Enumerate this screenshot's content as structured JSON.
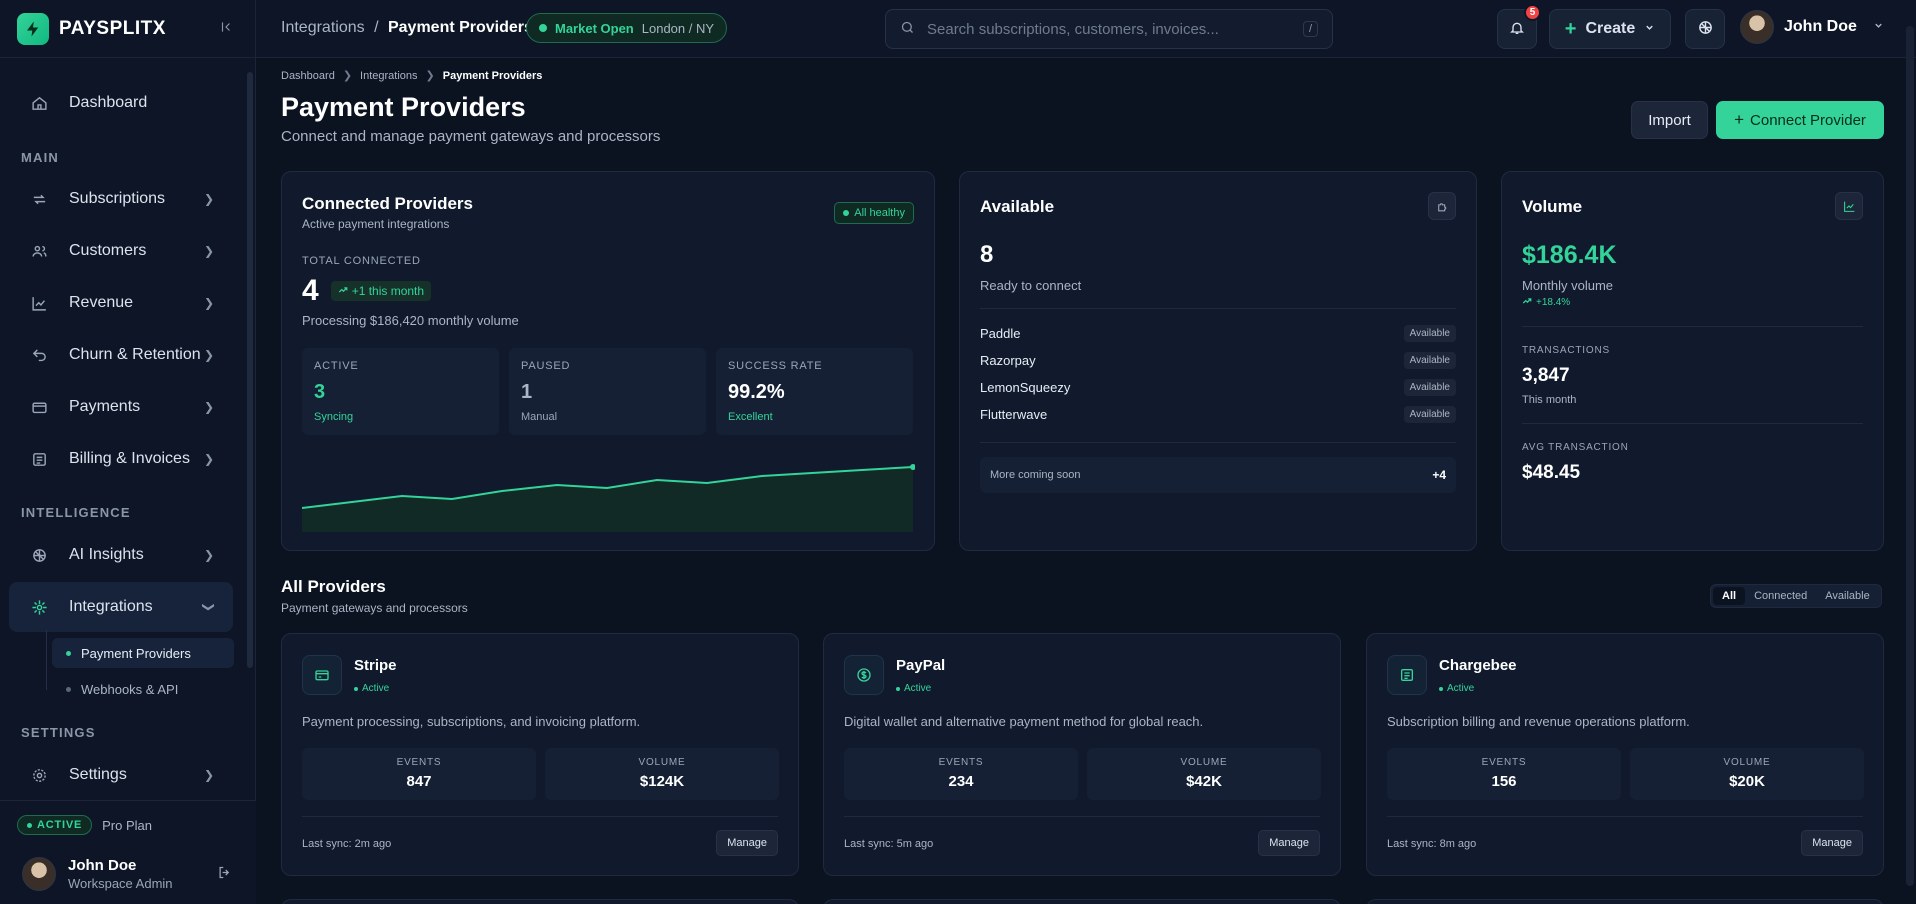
{
  "brand": {
    "name": "PAYSPLITX"
  },
  "sidebar": {
    "items": [
      {
        "label": "Dashboard"
      },
      {
        "label": "Subscriptions"
      },
      {
        "label": "Customers"
      },
      {
        "label": "Revenue"
      },
      {
        "label": "Churn & Retention"
      },
      {
        "label": "Payments"
      },
      {
        "label": "Billing & Invoices"
      },
      {
        "label": "AI Insights"
      },
      {
        "label": "Integrations"
      },
      {
        "label": "Settings"
      }
    ],
    "sections": {
      "main": "MAIN",
      "intelligence": "INTELLIGENCE",
      "settings": "SETTINGS"
    },
    "subitems": [
      {
        "label": "Payment Providers"
      },
      {
        "label": "Webhooks & API"
      }
    ],
    "plan": {
      "badge": "ACTIVE",
      "name": "Pro Plan"
    },
    "user": {
      "name": "John Doe",
      "role": "Workspace Admin"
    }
  },
  "topbar": {
    "crumb_parent": "Integrations",
    "crumb_sep": "/",
    "crumb_current": "Payment Providers",
    "market_status": "Market Open",
    "market_location": "London / NY",
    "search_placeholder": "Search subscriptions, customers, invoices...",
    "search_shortcut": "/",
    "notifications_count": "5",
    "create_label": "Create",
    "user_name": "John Doe"
  },
  "page": {
    "breadcrumb": [
      "Dashboard",
      "Integrations",
      "Payment Providers"
    ],
    "title": "Payment Providers",
    "subtitle": "Connect and manage payment gateways and processors",
    "import_label": "Import",
    "connect_label": "Connect Provider"
  },
  "connected": {
    "title": "Connected Providers",
    "subtitle": "Active payment integrations",
    "status": "All healthy",
    "total_label": "TOTAL CONNECTED",
    "total": "4",
    "delta": "+1 this month",
    "processing": "Processing $186,420 monthly volume",
    "stats": [
      {
        "label": "ACTIVE",
        "value": "3",
        "sub": "Syncing"
      },
      {
        "label": "PAUSED",
        "value": "1",
        "sub": "Manual"
      },
      {
        "label": "SUCCESS RATE",
        "value": "99.2%",
        "sub": "Excellent"
      }
    ]
  },
  "available": {
    "title": "Available",
    "count": "8",
    "count_sub": "Ready to connect",
    "providers": [
      {
        "name": "Paddle",
        "tag": "Available"
      },
      {
        "name": "Razorpay",
        "tag": "Available"
      },
      {
        "name": "LemonSqueezy",
        "tag": "Available"
      },
      {
        "name": "Flutterwave",
        "tag": "Available"
      }
    ],
    "more_label": "More coming soon",
    "more_count": "+4"
  },
  "volume": {
    "title": "Volume",
    "amount": "$186.4K",
    "amount_sub": "Monthly volume",
    "delta": "+18.4%",
    "tx_label": "TRANSACTIONS",
    "tx_value": "3,847",
    "tx_sub": "This month",
    "avg_label": "AVG TRANSACTION",
    "avg_value": "$48.45"
  },
  "all_providers": {
    "title": "All Providers",
    "subtitle": "Payment gateways and processors",
    "filters": [
      "All",
      "Connected",
      "Available"
    ],
    "cards": [
      {
        "name": "Stripe",
        "status": "Active",
        "desc": "Payment processing, subscriptions, and invoicing platform.",
        "events_label": "EVENTS",
        "events": "847",
        "volume_label": "VOLUME",
        "volume": "$124K",
        "sync": "Last sync: 2m ago",
        "manage": "Manage"
      },
      {
        "name": "PayPal",
        "status": "Active",
        "desc": "Digital wallet and alternative payment method for global reach.",
        "events_label": "EVENTS",
        "events": "234",
        "volume_label": "VOLUME",
        "volume": "$42K",
        "sync": "Last sync: 5m ago",
        "manage": "Manage"
      },
      {
        "name": "Chargebee",
        "status": "Active",
        "desc": "Subscription billing and revenue operations platform.",
        "events_label": "EVENTS",
        "events": "156",
        "volume_label": "VOLUME",
        "volume": "$20K",
        "sync": "Last sync: 8m ago",
        "manage": "Manage"
      }
    ]
  },
  "colors": {
    "accent": "#34d399",
    "bg": "#0b1220",
    "card": "#101a2c",
    "danger": "#ef4444"
  }
}
